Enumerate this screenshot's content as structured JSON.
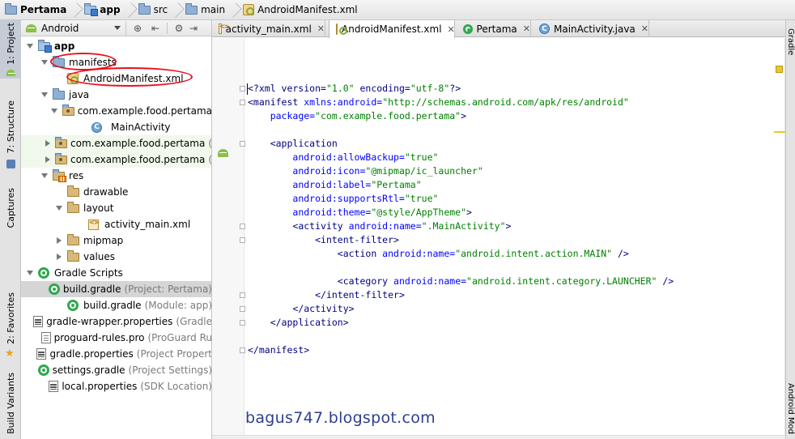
{
  "breadcrumb": [
    {
      "label": "Pertama",
      "icon": "folder-icon",
      "bold": true
    },
    {
      "label": "app",
      "icon": "module-folder-icon",
      "bold": true
    },
    {
      "label": "src",
      "icon": "folder-icon",
      "bold": false
    },
    {
      "label": "main",
      "icon": "folder-icon",
      "bold": false
    },
    {
      "label": "AndroidManifest.xml",
      "icon": "manifest-file-icon",
      "bold": false
    }
  ],
  "left_strip": {
    "project": "1: Project",
    "structure": "7: Structure",
    "captures": "Captures",
    "favorites": "2: Favorites",
    "build_variants": "Build Variants"
  },
  "project_panel": {
    "view_mode": "Android",
    "tree": [
      {
        "label": "app",
        "hint": "",
        "level": 0,
        "toggle": "open",
        "icon": "module-folder-icon",
        "bold": true
      },
      {
        "label": "manifests",
        "hint": "",
        "level": 1,
        "toggle": "open",
        "icon": "folder-icon"
      },
      {
        "label": "AndroidManifest.xml",
        "hint": "",
        "level": 2,
        "toggle": "none",
        "icon": "manifest-file-icon"
      },
      {
        "label": "java",
        "hint": "",
        "level": 1,
        "toggle": "open",
        "icon": "folder-icon"
      },
      {
        "label": "com.example.food.pertama",
        "hint": "",
        "level": 2,
        "toggle": "open",
        "icon": "package-icon"
      },
      {
        "label": "MainActivity",
        "hint": "",
        "level": 3,
        "toggle": "none",
        "icon": "class-icon"
      },
      {
        "label": "com.example.food.pertama",
        "hint": "(",
        "level": 2,
        "toggle": "closed",
        "icon": "package-icon",
        "green": true
      },
      {
        "label": "com.example.food.pertama",
        "hint": "(",
        "level": 2,
        "toggle": "closed",
        "icon": "package-icon",
        "green": true
      },
      {
        "label": "res",
        "hint": "",
        "level": 1,
        "toggle": "open",
        "icon": "res-folder-icon"
      },
      {
        "label": "drawable",
        "hint": "",
        "level": 2,
        "toggle": "none",
        "icon": "folder-icon"
      },
      {
        "label": "layout",
        "hint": "",
        "level": 2,
        "toggle": "open",
        "icon": "folder-icon"
      },
      {
        "label": "activity_main.xml",
        "hint": "",
        "level": 3,
        "toggle": "none",
        "icon": "xml-file-icon"
      },
      {
        "label": "mipmap",
        "hint": "",
        "level": 2,
        "toggle": "closed",
        "icon": "folder-icon"
      },
      {
        "label": "values",
        "hint": "",
        "level": 2,
        "toggle": "closed",
        "icon": "folder-icon"
      },
      {
        "label": "Gradle Scripts",
        "hint": "",
        "level": 0,
        "toggle": "open",
        "icon": "gradle-icon"
      },
      {
        "label": "build.gradle",
        "hint": "(Project: Pertama)",
        "level": 1,
        "toggle": "none",
        "icon": "gradle-icon",
        "selected": true
      },
      {
        "label": "build.gradle",
        "hint": "(Module: app)",
        "level": 1,
        "toggle": "none",
        "icon": "gradle-icon"
      },
      {
        "label": "gradle-wrapper.properties",
        "hint": "(Gradle",
        "level": 1,
        "toggle": "none",
        "icon": "properties-file-icon"
      },
      {
        "label": "proguard-rules.pro",
        "hint": "(ProGuard Ru",
        "level": 1,
        "toggle": "none",
        "icon": "proguard-file-icon"
      },
      {
        "label": "gradle.properties",
        "hint": "(Project Propert",
        "level": 1,
        "toggle": "none",
        "icon": "properties-file-icon"
      },
      {
        "label": "settings.gradle",
        "hint": "(Project Settings)",
        "level": 1,
        "toggle": "none",
        "icon": "gradle-icon"
      },
      {
        "label": "local.properties",
        "hint": "(SDK Location)",
        "level": 1,
        "toggle": "none",
        "icon": "properties-file-icon"
      }
    ]
  },
  "editor": {
    "tabs": [
      {
        "label": "activity_main.xml",
        "icon": "xml-file-icon",
        "active": false
      },
      {
        "label": "AndroidManifest.xml",
        "icon": "manifest-file-icon",
        "active": true
      },
      {
        "label": "Pertama",
        "icon": "gradle-icon",
        "active": false
      },
      {
        "label": "MainActivity.java",
        "icon": "class-icon",
        "active": false
      }
    ],
    "lines": [
      [
        {
          "t": "<?xml version=",
          "c": "pi"
        },
        {
          "t": "\"1.0\"",
          "c": "val"
        },
        {
          "t": " encoding=",
          "c": "pi"
        },
        {
          "t": "\"utf-8\"",
          "c": "val"
        },
        {
          "t": "?>",
          "c": "pi"
        }
      ],
      [
        {
          "t": "<manifest ",
          "c": "tag"
        },
        {
          "t": "xmlns:android=",
          "c": "attr"
        },
        {
          "t": "\"http://schemas.android.com/apk/res/android\"",
          "c": "val"
        }
      ],
      [
        {
          "t": "    ",
          "c": "plain"
        },
        {
          "t": "package=",
          "c": "attr"
        },
        {
          "t": "\"com.example.food.pertama\"",
          "c": "val"
        },
        {
          "t": ">",
          "c": "tag"
        }
      ],
      [],
      [
        {
          "t": "    ",
          "c": "plain"
        },
        {
          "t": "<application",
          "c": "tag"
        }
      ],
      [
        {
          "t": "        ",
          "c": "plain"
        },
        {
          "t": "android:allowBackup=",
          "c": "attr"
        },
        {
          "t": "\"true\"",
          "c": "val"
        }
      ],
      [
        {
          "t": "        ",
          "c": "plain"
        },
        {
          "t": "android:icon=",
          "c": "attr"
        },
        {
          "t": "\"@mipmap/ic_launcher\"",
          "c": "val"
        }
      ],
      [
        {
          "t": "        ",
          "c": "plain"
        },
        {
          "t": "android:label=",
          "c": "attr"
        },
        {
          "t": "\"Pertama\"",
          "c": "val"
        }
      ],
      [
        {
          "t": "        ",
          "c": "plain"
        },
        {
          "t": "android:supportsRtl=",
          "c": "attr"
        },
        {
          "t": "\"true\"",
          "c": "val"
        }
      ],
      [
        {
          "t": "        ",
          "c": "plain"
        },
        {
          "t": "android:theme=",
          "c": "attr"
        },
        {
          "t": "\"@style/AppTheme\"",
          "c": "val"
        },
        {
          "t": ">",
          "c": "tag"
        }
      ],
      [
        {
          "t": "        ",
          "c": "plain"
        },
        {
          "t": "<activity ",
          "c": "tag"
        },
        {
          "t": "android:name=",
          "c": "attr"
        },
        {
          "t": "\".MainActivity\"",
          "c": "val"
        },
        {
          "t": ">",
          "c": "tag"
        }
      ],
      [
        {
          "t": "            ",
          "c": "plain"
        },
        {
          "t": "<intent-filter>",
          "c": "tag"
        }
      ],
      [
        {
          "t": "                ",
          "c": "plain"
        },
        {
          "t": "<action ",
          "c": "tag"
        },
        {
          "t": "android:name=",
          "c": "attr"
        },
        {
          "t": "\"android.intent.action.MAIN\"",
          "c": "val"
        },
        {
          "t": " />",
          "c": "tag"
        }
      ],
      [],
      [
        {
          "t": "                ",
          "c": "plain"
        },
        {
          "t": "<category ",
          "c": "tag"
        },
        {
          "t": "android:name=",
          "c": "attr"
        },
        {
          "t": "\"android.intent.category.LAUNCHER\"",
          "c": "val"
        },
        {
          "t": " />",
          "c": "tag"
        }
      ],
      [
        {
          "t": "            ",
          "c": "plain"
        },
        {
          "t": "</intent-filter>",
          "c": "tag"
        }
      ],
      [
        {
          "t": "        ",
          "c": "plain"
        },
        {
          "t": "</activity>",
          "c": "tag"
        }
      ],
      [
        {
          "t": "    ",
          "c": "plain"
        },
        {
          "t": "</application>",
          "c": "tag"
        }
      ],
      [],
      [
        {
          "t": "</manifest>",
          "c": "tag"
        }
      ]
    ]
  },
  "right_strip": {
    "gradle": "Gradle",
    "android_model": "Android Mod"
  },
  "watermark": "bagus747.blogspot.com",
  "colors": {
    "annotation_ellipse": "#e8121e",
    "selected_row": "#d5d5d5",
    "xml_tag": "#000080",
    "xml_attr": "#0000ff",
    "xml_value": "#008000"
  }
}
